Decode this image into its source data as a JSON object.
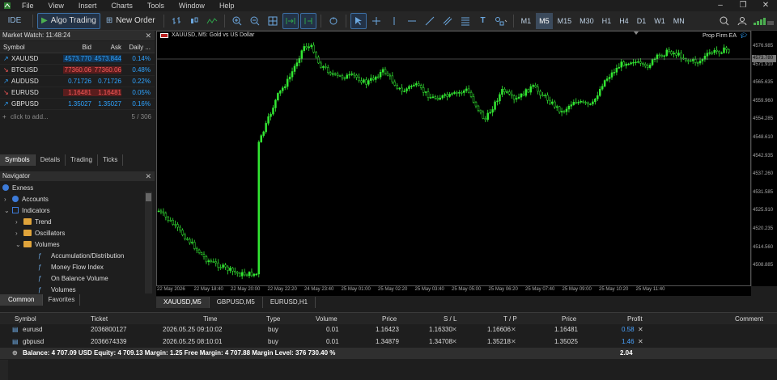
{
  "menu": [
    "File",
    "View",
    "Insert",
    "Charts",
    "Tools",
    "Window",
    "Help"
  ],
  "toolbar": {
    "ide_label": "IDE",
    "algo_label": "Algo Trading",
    "new_order_label": "New Order",
    "timeframes": [
      "M1",
      "M5",
      "M15",
      "M30",
      "H1",
      "H4",
      "D1",
      "W1",
      "MN"
    ],
    "active_timeframe": "M5"
  },
  "market_watch": {
    "title": "Market Watch: 11:48:24",
    "columns": [
      "Symbol",
      "Bid",
      "Ask",
      "Daily ..."
    ],
    "rows": [
      {
        "symbol": "XAUUSD",
        "bid": "4573.770",
        "ask": "4573.844",
        "daily": "0.14%",
        "dir": "up"
      },
      {
        "symbol": "BTCUSD",
        "bid": "77360.06",
        "ask": "77360.06",
        "daily": "0.48%",
        "dir": "down"
      },
      {
        "symbol": "AUDUSD",
        "bid": "0.71726",
        "ask": "0.71726",
        "daily": "0.22%",
        "dir": "up"
      },
      {
        "symbol": "EURUSD",
        "bid": "1.16481",
        "ask": "1.16481",
        "daily": "0.05%",
        "dir": "down"
      },
      {
        "symbol": "GBPUSD",
        "bid": "1.35027",
        "ask": "1.35027",
        "daily": "0.16%",
        "dir": "up"
      }
    ],
    "add_label": "click to add...",
    "count": "5 / 306",
    "tabs": [
      "Symbols",
      "Details",
      "Trading",
      "Ticks"
    ],
    "active_tab": "Symbols"
  },
  "navigator": {
    "title": "Navigator",
    "items": [
      {
        "label": "Exness",
        "level": 0
      },
      {
        "label": "Accounts",
        "level": 1
      },
      {
        "label": "Indicators",
        "level": 1
      },
      {
        "label": "Trend",
        "level": 2
      },
      {
        "label": "Oscillators",
        "level": 2
      },
      {
        "label": "Volumes",
        "level": 2
      },
      {
        "label": "Accumulation/Distribution",
        "level": 3
      },
      {
        "label": "Money Flow Index",
        "level": 3
      },
      {
        "label": "On Balance Volume",
        "level": 3
      },
      {
        "label": "Volumes",
        "level": 3
      }
    ],
    "tabs": [
      "Common",
      "Favorites"
    ],
    "active_tab": "Common"
  },
  "chart": {
    "title": "XAUUSD, M5:  Gold vs US Dollar",
    "ea_label": "Prop Firm EA",
    "current_price": "4573.780",
    "y_labels": [
      "4576.985",
      "4571.910",
      "4565.635",
      "4559.960",
      "4554.285",
      "4548.610",
      "4542.935",
      "4537.260",
      "4531.585",
      "4525.910",
      "4520.235",
      "4514.560",
      "4508.885"
    ],
    "x_labels": [
      "22 May 2026",
      "22 May 18:40",
      "22 May 20:00",
      "22 May 22:20",
      "24 May 23:40",
      "25 May 01:00",
      "25 May 02:20",
      "25 May 03:40",
      "25 May 05:00",
      "25 May 06:20",
      "25 May 07:40",
      "25 May 09:00",
      "25 May 10:20",
      "25 May 11:40"
    ],
    "candle_color": "#33e833",
    "tabs": [
      "XAUUSD,M5",
      "GBPUSD,M5",
      "EURUSD,H1"
    ],
    "active_tab": "XAUUSD,M5"
  },
  "trade": {
    "columns": [
      "Symbol",
      "Ticket",
      "Time",
      "Type",
      "Volume",
      "Price",
      "S / L",
      "T / P",
      "Price",
      "Profit",
      "Comment"
    ],
    "rows": [
      {
        "symbol": "eurusd",
        "ticket": "2036800127",
        "time": "2026.05.25 09:10:02",
        "type": "buy",
        "volume": "0.01",
        "price": "1.16423",
        "sl": "1.16330",
        "tp": "1.16606",
        "cur": "1.16481",
        "profit": "0.58"
      },
      {
        "symbol": "gbpusd",
        "ticket": "2036674339",
        "time": "2026.05.25 08:10:01",
        "type": "buy",
        "volume": "0.01",
        "price": "1.34879",
        "sl": "1.34708",
        "tp": "1.35218",
        "cur": "1.35025",
        "profit": "1.46"
      }
    ],
    "balance_line": "Balance: 4 707.09 USD  Equity: 4 709.13  Margin: 1.25  Free Margin: 4 707.88  Margin Level: 376 730.40 %",
    "total_profit": "2.04"
  }
}
